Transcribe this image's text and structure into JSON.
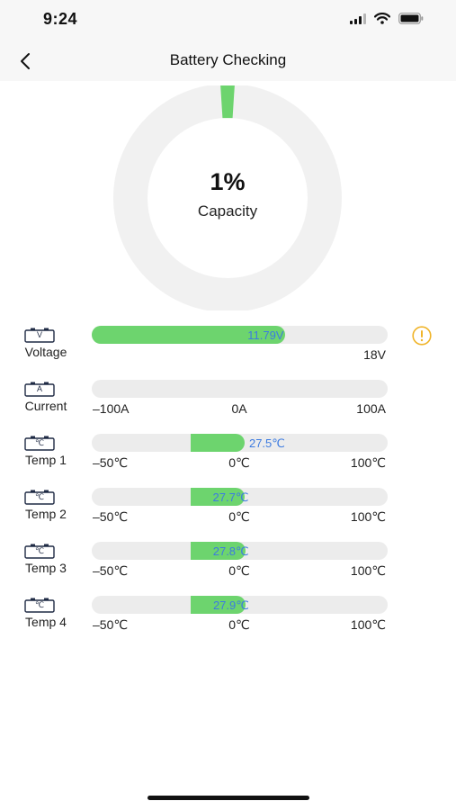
{
  "status_bar": {
    "time": "9:24"
  },
  "nav": {
    "title": "Battery Checking",
    "back_icon": "chevron-left-icon"
  },
  "gauge": {
    "percent_text": "1%",
    "label": "Capacity",
    "value_fraction": 0.01,
    "track_color": "#f1f1f1",
    "fill_color": "#6dd46e"
  },
  "colors": {
    "fill": "#6dd46e",
    "track": "#ececec",
    "value_text": "#3d7be0",
    "warning": "#f0b429"
  },
  "meters": [
    {
      "id": "voltage",
      "icon": "battery-voltage-icon",
      "unit": "V",
      "label": "Voltage",
      "value_text": "11.79V",
      "value": 11.79,
      "min": 0,
      "max": 18,
      "scale": {
        "min": "",
        "mid": "",
        "max": "18V"
      },
      "warning": true
    },
    {
      "id": "current",
      "icon": "battery-current-icon",
      "unit": "A",
      "label": "Current",
      "value_text": "",
      "value": 0,
      "min": -100,
      "max": 100,
      "scale": {
        "min": "–100A",
        "mid": "0A",
        "max": "100A"
      },
      "warning": false
    },
    {
      "id": "temp1",
      "icon": "battery-temp-icon",
      "unit": "℃",
      "label": "Temp 1",
      "value_text": "27.5℃",
      "value": 27.5,
      "min": -50,
      "max": 100,
      "scale": {
        "min": "–50℃",
        "mid": "0℃",
        "max": "100℃"
      },
      "warning": false
    },
    {
      "id": "temp2",
      "icon": "battery-temp-icon",
      "unit": "℃",
      "label": "Temp 2",
      "value_text": "27.7℃",
      "value": 27.7,
      "min": -50,
      "max": 100,
      "scale": {
        "min": "–50℃",
        "mid": "0℃",
        "max": "100℃"
      },
      "warning": false
    },
    {
      "id": "temp3",
      "icon": "battery-temp-icon",
      "unit": "℃",
      "label": "Temp 3",
      "value_text": "27.8℃",
      "value": 27.8,
      "min": -50,
      "max": 100,
      "scale": {
        "min": "–50℃",
        "mid": "0℃",
        "max": "100℃"
      },
      "warning": false
    },
    {
      "id": "temp4",
      "icon": "battery-temp-icon",
      "unit": "℃",
      "label": "Temp 4",
      "value_text": "27.9℃",
      "value": 27.9,
      "min": -50,
      "max": 100,
      "scale": {
        "min": "–50℃",
        "mid": "0℃",
        "max": "100℃"
      },
      "warning": false
    }
  ]
}
